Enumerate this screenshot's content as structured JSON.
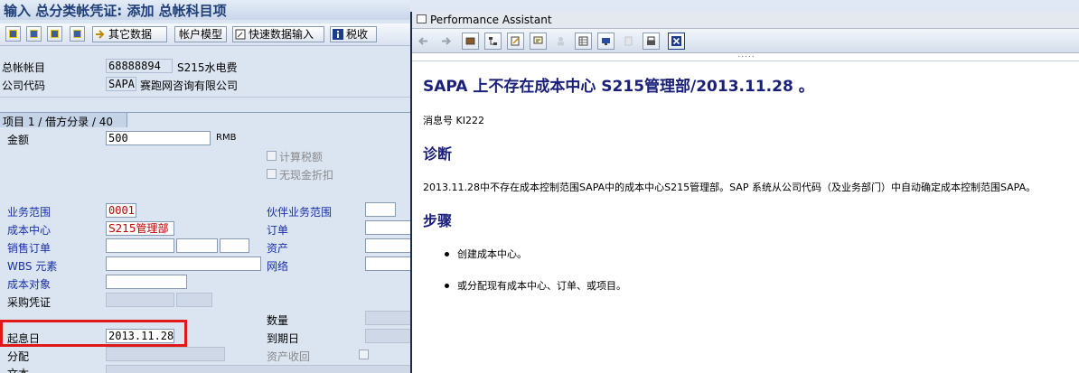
{
  "window": {
    "title": "输入 总分类帐凭证: 添加 总帐科目项"
  },
  "toolbar": {
    "other_data": "其它数据",
    "account_model": "帐户模型",
    "fast_entry": "快速数据输入",
    "tax": "税收"
  },
  "header": {
    "gl_account_label": "总帐帐目",
    "gl_account_value": "68888894",
    "gl_account_desc": "S215水电费",
    "company_code_label": "公司代码",
    "company_code_value": "SAPA",
    "company_code_desc": "赛跑网咨询有限公司"
  },
  "item_tab": {
    "label": "项目 1 / 借方分录 / 40"
  },
  "form": {
    "amount_label": "金额",
    "amount_value": "500",
    "currency": "RMB",
    "calc_tax_label": "计算税额",
    "cash_discount_label": "无现金折扣",
    "business_area_label": "业务范围",
    "business_area_value": "0001",
    "partner_ba_label": "伙伴业务范围",
    "cost_center_label": "成本中心",
    "cost_center_value": "S215管理部",
    "order_label": "订单",
    "sales_order_label": "销售订单",
    "asset_label": "资产",
    "wbs_label": "WBS 元素",
    "network_label": "网络",
    "cost_object_label": "成本对象",
    "purchasing_doc_label": "采购凭证",
    "quantity_label": "数量",
    "value_date_label": "起息日",
    "value_date_value": "2013.11.28",
    "due_date_label": "到期日",
    "assignment_label": "分配",
    "asset_retirement_label": "资产收回",
    "text_label": "文本"
  },
  "assistant": {
    "title": "Performance Assistant",
    "heading": "SAPA 上不存在成本中心  S215管理部/2013.11.28 。",
    "message_no": "消息号  KI222",
    "diagnosis_title": "诊断",
    "diagnosis_text": "2013.11.28中不存在成本控制范围SAPA中的成本中心S215管理部。SAP 系统从公司代码（及业务部门）中自动确定成本控制范围SAPA。",
    "steps_title": "步骤",
    "steps": [
      "创建成本中心。",
      "或分配现有成本中心、订单、或项目。"
    ],
    "dots": "....."
  }
}
